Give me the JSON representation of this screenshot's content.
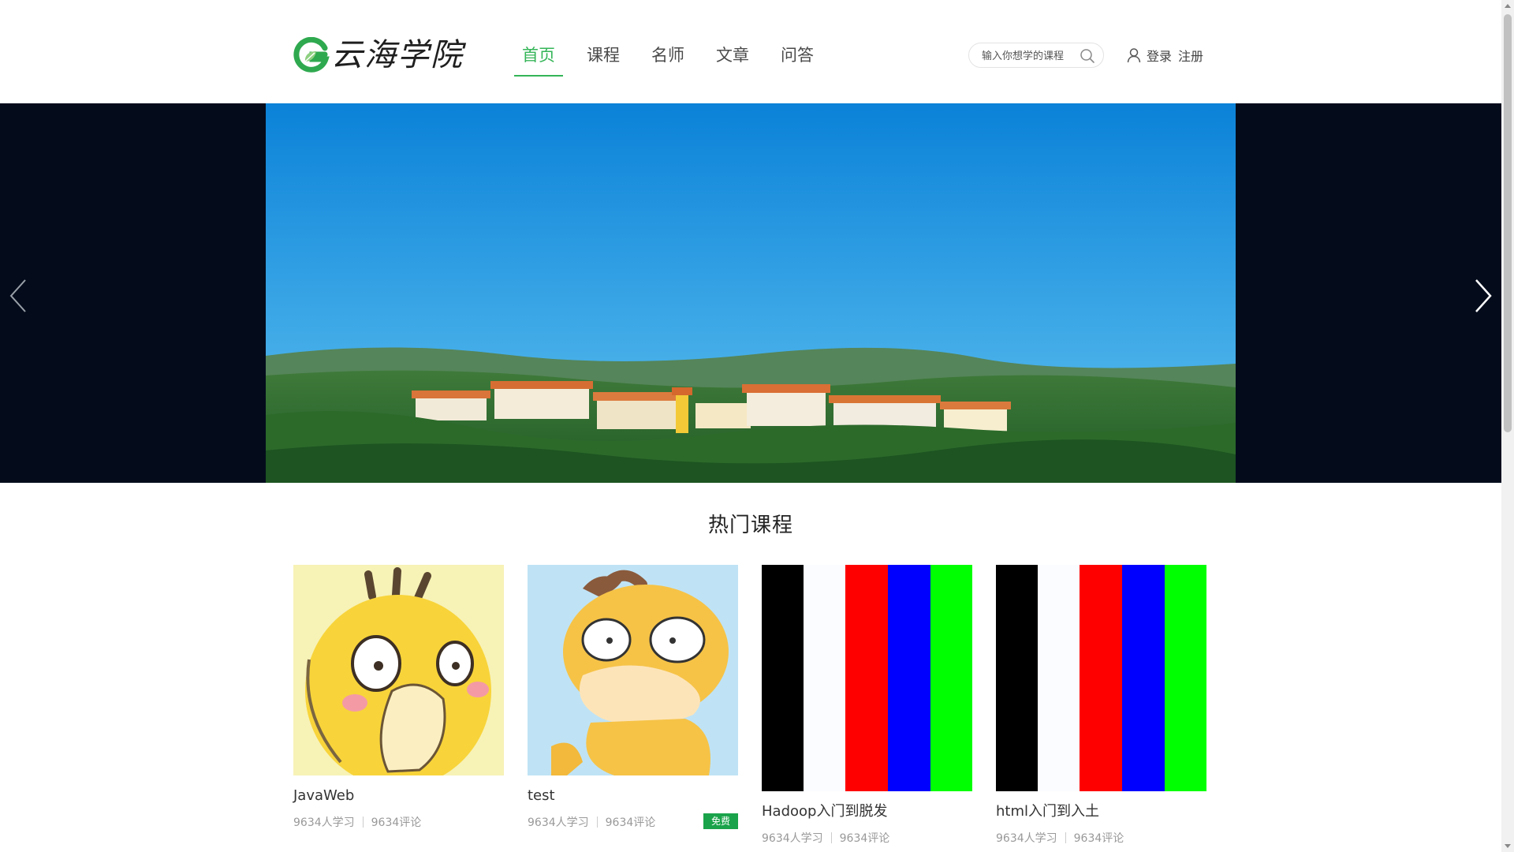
{
  "brand": {
    "name": "云海学院",
    "accent": "#35b558"
  },
  "nav": {
    "items": [
      {
        "label": "首页",
        "active": true
      },
      {
        "label": "课程",
        "active": false
      },
      {
        "label": "名师",
        "active": false
      },
      {
        "label": "文章",
        "active": false
      },
      {
        "label": "问答",
        "active": false
      }
    ]
  },
  "search": {
    "placeholder": "输入你想学的课程",
    "icon": "search-icon"
  },
  "user": {
    "icon": "user-icon",
    "login": "登录",
    "register": "注册"
  },
  "banner": {
    "image": "campus-landscape-photo",
    "prev_icon": "chevron-left-icon",
    "next_icon": "chevron-right-icon"
  },
  "hot_courses": {
    "title": "热门课程",
    "courses": [
      {
        "name": "JavaWeb",
        "students": "9634人学习",
        "comments": "9634评论",
        "thumb": "yellow-duck-cartoon"
      },
      {
        "name": "test",
        "students": "9634人学习",
        "comments": "9634评论",
        "badge": "免费",
        "thumb": "duck-cartoon-blue-bg"
      },
      {
        "name": "Hadoop入门到脱发",
        "students": "9634人学习",
        "comments": "9634评论",
        "thumb": "color-bars"
      },
      {
        "name": "html入门到入土",
        "students": "9634人学习",
        "comments": "9634评论",
        "thumb": "color-bars"
      }
    ]
  }
}
